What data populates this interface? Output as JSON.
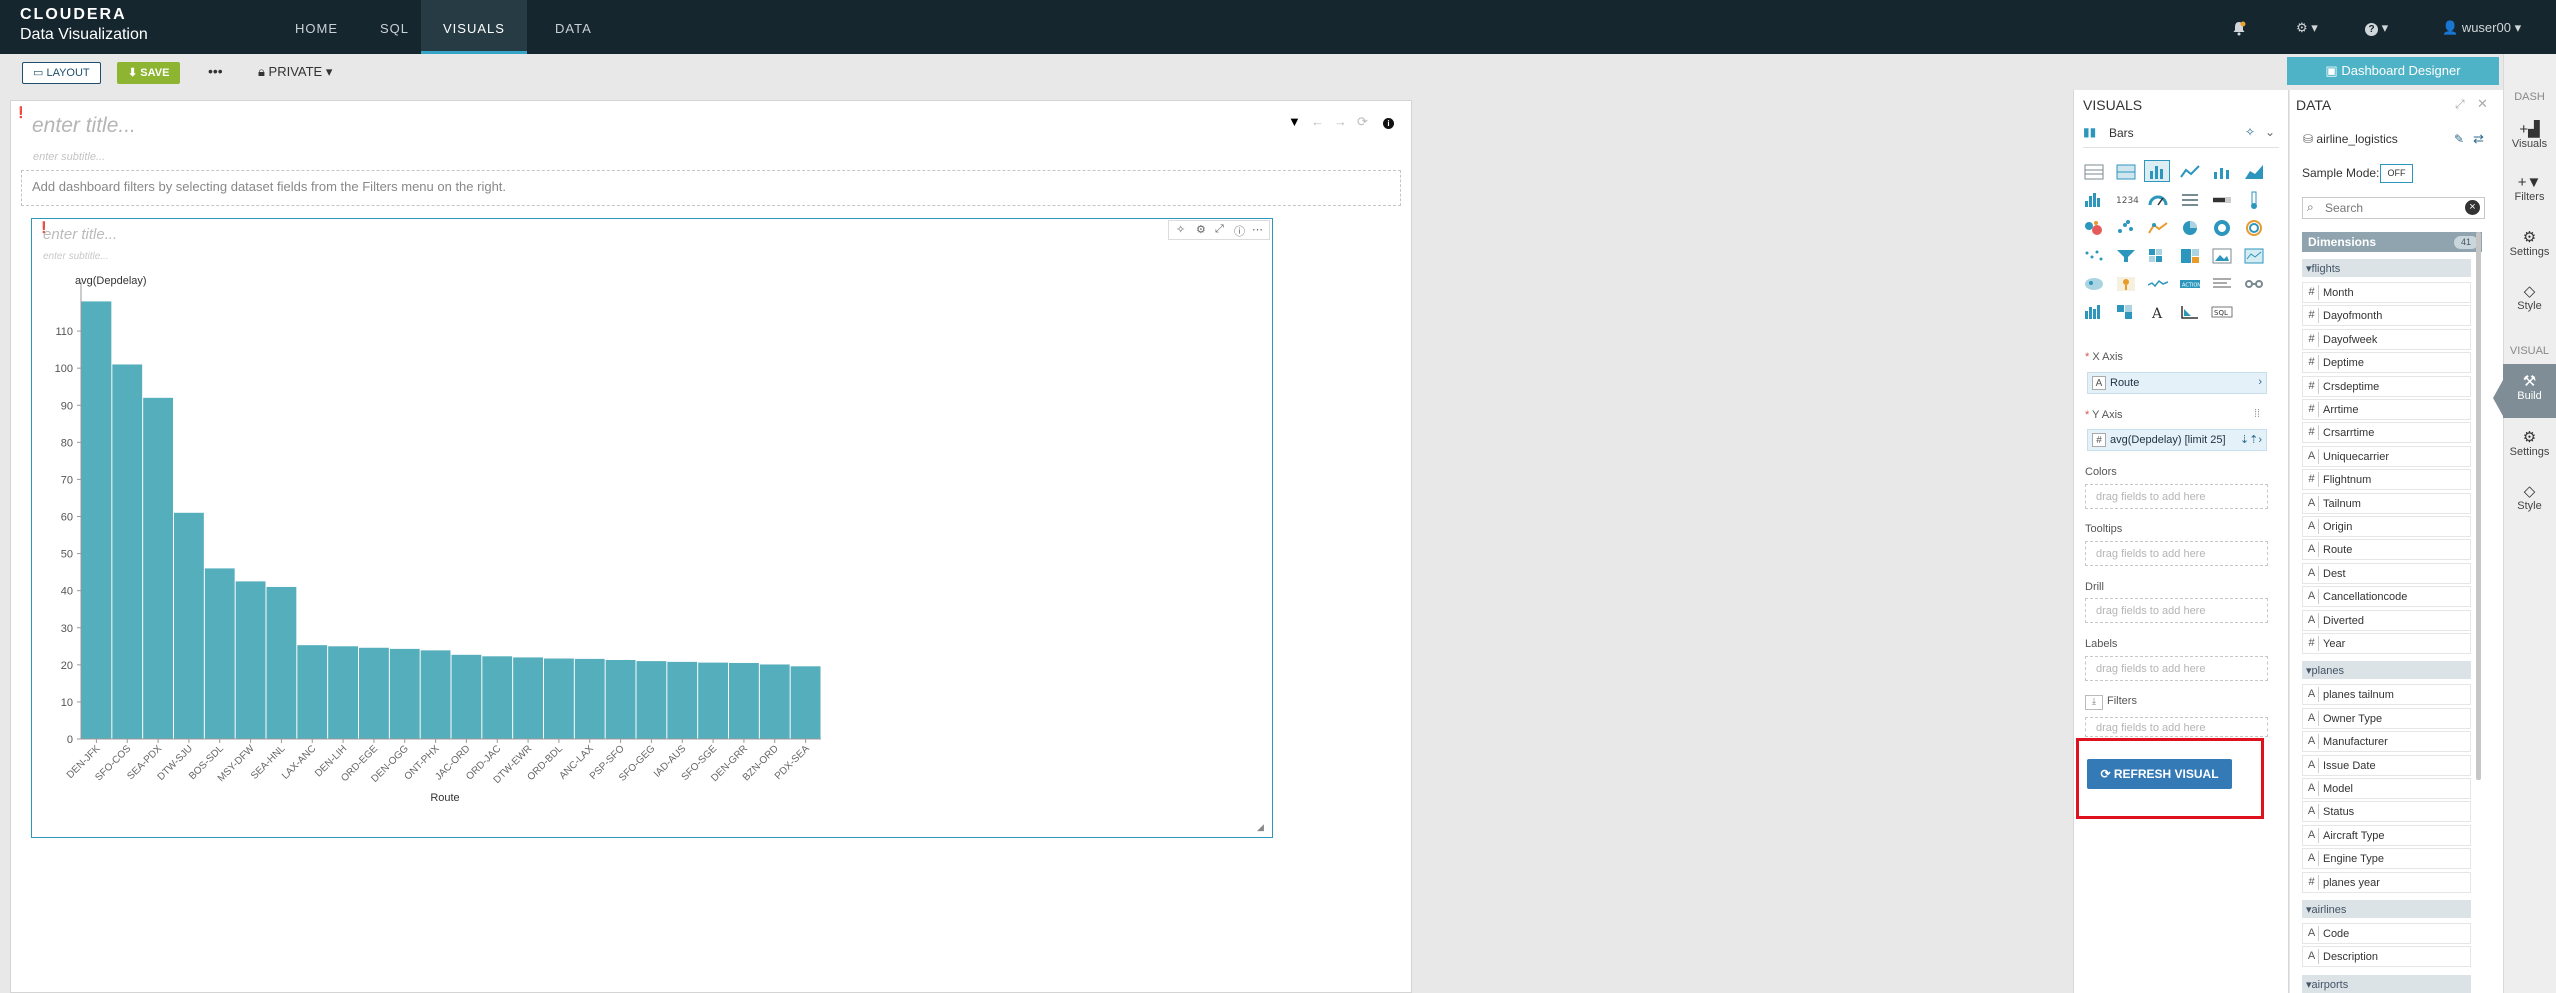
{
  "nav": {
    "brand_line1": "CLOUDERA",
    "brand_line2": "Data Visualization",
    "tabs": [
      "HOME",
      "SQL",
      "VISUALS",
      "DATA"
    ],
    "active_tab": "VISUALS",
    "user": "wuser00"
  },
  "toolbar": {
    "layout_label": "LAYOUT",
    "save_label": "SAVE",
    "more_label": "•••",
    "private_label": "PRIVATE"
  },
  "dashboard": {
    "title_placeholder": "enter title...",
    "subtitle_placeholder": "enter subtitle...",
    "filters_hint": "Add dashboard filters by selecting dataset fields from the Filters menu on the right."
  },
  "visual": {
    "title_placeholder": "enter title...",
    "subtitle_placeholder": "enter subtitle..."
  },
  "chart_data": {
    "type": "bar",
    "title": "",
    "ylabel": "avg(Depdelay)",
    "xlabel": "Route",
    "ylim": [
      0,
      120
    ],
    "yticks": [
      0,
      10,
      20,
      30,
      40,
      50,
      60,
      70,
      80,
      90,
      100,
      110
    ],
    "categories": [
      "DEN-JFK",
      "SFO-COS",
      "SEA-PDX",
      "DTW-SJU",
      "BOS-SDL",
      "MSY-DFW",
      "SEA-HNL",
      "LAX-ANC",
      "DEN-LIH",
      "ORD-EGE",
      "DEN-OGG",
      "ONT-PHX",
      "JAC-ORD",
      "ORD-JAC",
      "DTW-EWR",
      "ORD-BDL",
      "ANC-LAX",
      "PSP-SFO",
      "SFO-GEG",
      "IAD-AUS",
      "SFO-SGE",
      "DEN-GRR",
      "BZN-ORD",
      "PDX-SEA"
    ],
    "values": [
      118,
      101,
      92,
      61,
      46,
      42.5,
      41,
      25.3,
      25,
      24.6,
      24.3,
      23.9,
      22.7,
      22.3,
      22,
      21.7,
      21.6,
      21.3,
      21,
      20.8,
      20.6,
      20.5,
      20.1,
      19.6
    ],
    "bar_color": "#55aebb"
  },
  "visuals_panel": {
    "header": "VISUALS",
    "visual_type": "Bars",
    "x_axis_label": "X Axis",
    "x_axis_field": "Route",
    "y_axis_label": "Y Axis",
    "y_axis_field": "avg(Depdelay) [limit 25]",
    "colors_label": "Colors",
    "tooltips_label": "Tooltips",
    "drill_label": "Drill",
    "labels_label": "Labels",
    "filters_label": "Filters",
    "drop_hint": "drag fields to add here",
    "refresh_label": "REFRESH VISUAL",
    "icon_text_1234": "1234",
    "icon_text_sql": "SQL",
    "icon_text_action": "ACTION"
  },
  "data_panel": {
    "header": "DATA",
    "dataset": "airline_logistics",
    "sample_mode_label": "Sample Mode:",
    "sample_mode_value": "OFF",
    "search_placeholder": "Search",
    "dimensions_label": "Dimensions",
    "dimensions_count": "41",
    "groups": [
      {
        "name": "flights",
        "fields": [
          {
            "t": "#",
            "n": "Month"
          },
          {
            "t": "#",
            "n": "Dayofmonth"
          },
          {
            "t": "#",
            "n": "Dayofweek"
          },
          {
            "t": "#",
            "n": "Deptime"
          },
          {
            "t": "#",
            "n": "Crsdeptime"
          },
          {
            "t": "#",
            "n": "Arrtime"
          },
          {
            "t": "#",
            "n": "Crsarrtime"
          },
          {
            "t": "A",
            "n": "Uniquecarrier"
          },
          {
            "t": "#",
            "n": "Flightnum"
          },
          {
            "t": "A",
            "n": "Tailnum"
          },
          {
            "t": "A",
            "n": "Origin"
          },
          {
            "t": "A",
            "n": "Route"
          },
          {
            "t": "A",
            "n": "Dest"
          },
          {
            "t": "A",
            "n": "Cancellationcode"
          },
          {
            "t": "A",
            "n": "Diverted"
          },
          {
            "t": "#",
            "n": "Year"
          }
        ]
      },
      {
        "name": "planes",
        "fields": [
          {
            "t": "A",
            "n": "planes tailnum"
          },
          {
            "t": "A",
            "n": "Owner Type"
          },
          {
            "t": "A",
            "n": "Manufacturer"
          },
          {
            "t": "A",
            "n": "Issue Date"
          },
          {
            "t": "A",
            "n": "Model"
          },
          {
            "t": "A",
            "n": "Status"
          },
          {
            "t": "A",
            "n": "Aircraft Type"
          },
          {
            "t": "A",
            "n": "Engine Type"
          },
          {
            "t": "#",
            "n": "planes year"
          }
        ]
      },
      {
        "name": "airlines",
        "fields": [
          {
            "t": "A",
            "n": "Code"
          },
          {
            "t": "A",
            "n": "Description"
          }
        ]
      },
      {
        "name": "airports",
        "fields": []
      }
    ]
  },
  "right_rail": {
    "dashboard_designer_label": "Dashboard Designer",
    "dash_section": "DASH",
    "visual_section": "VISUAL",
    "dash_items": [
      "Visuals",
      "Filters",
      "Settings",
      "Style"
    ],
    "visual_items": [
      "Build",
      "Settings",
      "Style"
    ],
    "active_item": "Build"
  }
}
